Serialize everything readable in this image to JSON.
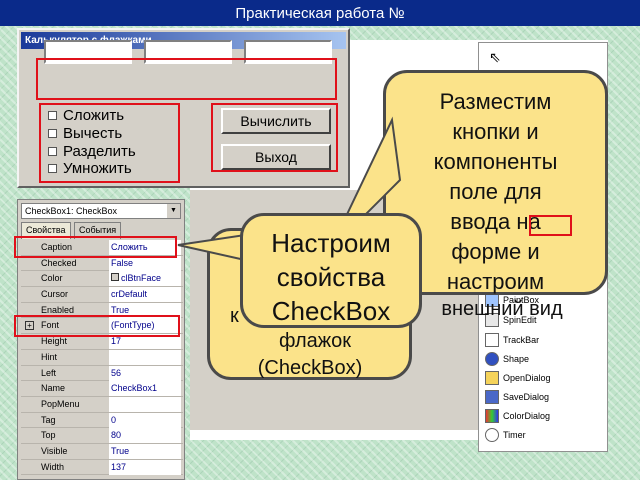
{
  "header": {
    "title": "Практическая работа №"
  },
  "form": {
    "title": "Калькулятор с флажками",
    "checkboxes": [
      "Сложить",
      "Вычесть",
      "Разделить",
      "Умножить"
    ],
    "buttons": {
      "calculate": "Вычислить",
      "exit": "Выход"
    }
  },
  "inspector": {
    "object": "CheckBox1: CheckBox",
    "tabs": [
      "Свойства",
      "События"
    ],
    "properties": [
      {
        "name": "Caption",
        "value": "Сложить"
      },
      {
        "name": "Checked",
        "value": "False"
      },
      {
        "name": "Color",
        "value": "clBtnFace"
      },
      {
        "name": "Cursor",
        "value": "crDefault"
      },
      {
        "name": "Enabled",
        "value": "True"
      },
      {
        "name": "Font",
        "value": "(FontType)"
      },
      {
        "name": "Height",
        "value": "17"
      },
      {
        "name": "Hint",
        "value": ""
      },
      {
        "name": "Left",
        "value": "56"
      },
      {
        "name": "Name",
        "value": "CheckBox1"
      },
      {
        "name": "PopMenu",
        "value": ""
      },
      {
        "name": "Tag",
        "value": "0"
      },
      {
        "name": "Top",
        "value": "80"
      },
      {
        "name": "Visible",
        "value": "True"
      },
      {
        "name": "Width",
        "value": "137"
      }
    ]
  },
  "palette": {
    "items": [
      "PaintBox",
      "SpinEdit",
      "TrackBar",
      "Shape",
      "OpenDialog",
      "SaveDialog",
      "ColorDialog",
      "Timer"
    ]
  },
  "callouts": {
    "main": [
      "Разместим",
      "кнопки  и",
      "компоненты",
      "поле для",
      "ввода на",
      "форме и",
      "настроим",
      "внешний вид"
    ],
    "front": [
      "Настроим",
      "свойства",
      "CheckBox"
    ],
    "under": [
      "к",
      "флажок",
      "(CheckBox)"
    ]
  },
  "colors": {
    "highlight": "#e0101a",
    "callout": "#fbe38a",
    "titlebar": "#0a2a8a"
  }
}
